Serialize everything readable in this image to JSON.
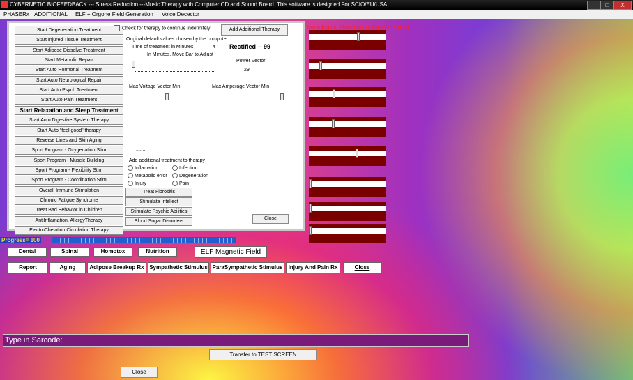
{
  "window": {
    "title": "CYBERNETIC BIOFEEDBACK  ---  Stress Reduction    ---Music Therapy with Computer CD and Sound Board.  This software is designed For SCIO/EU/USA",
    "controls": [
      "_",
      "□",
      "X"
    ]
  },
  "menu": [
    "PHASERx",
    "ADDITIONAL",
    "ELF + Orgone Field Generation",
    "Voice Decector"
  ],
  "treatments": [
    "Start Degeneration Treatment",
    "Start Injured Tissue Treatment",
    "Start Adipose Dissolve Treatment",
    "Start Metabolic Repair",
    "Start Auto Hormonal Treatment",
    "Start Auto Neurological Repair",
    "Start Auto Psych Treatment",
    "Start Auto Pain Treatment",
    "Start Relaxation and Sleep Treatment",
    "Start Auto Digestive System Therapy",
    "Start Auto \"feel good\" therapy",
    "Reverse Lines and Skin Aging",
    "Sport Program - Oxygenation Stim",
    "Sport Program - Muscle Building",
    "Sport Program - Flexibility Stim",
    "Sport Program - Coordination Stim",
    "Overall Immune Stimulation",
    "Chronic Fatigue Syndrome",
    "Treat Bad Behavior  in Children",
    "AntiInflamation, AllergyTherapy",
    "ElectroChelation Circulation Therapy"
  ],
  "panel": {
    "check_continue": "Check for therapy to continue indefinitely",
    "add_therapy_button": "Add Additional Therapy",
    "defaults_note": "Original default values chosen by the computer",
    "time_label": "Time of treatment in Minutes",
    "time_value": "4",
    "minutes_note": "In Minutes, Move Bar to Adjust",
    "rectified": "Rectified -- 99",
    "power_vector_label": "Power Vector",
    "power_vector_value": "29",
    "voltage_label": "Max    Voltage Vector    Min",
    "amperage_label": "Max    Amperage Vector    Min",
    "dots": ".......",
    "add_additional_label": "Add additional treatment to therapy",
    "options": [
      [
        "Inflamation",
        "Infection"
      ],
      [
        "Metabolic error",
        "Degeneration"
      ],
      [
        "Injury",
        "Pain"
      ]
    ],
    "extra_buttons": [
      "Treat Fibrositis",
      "Stimulate Intellect",
      "Stimulate Psychic Abilities",
      "Blood Sugar Disorders"
    ],
    "close_button": "Close"
  },
  "side": {
    "heading": "Neurological Aberation In Stanine Percent",
    "slider_positions": [
      0.65,
      0.14,
      0.32,
      0.31,
      0.63,
      0.0,
      0.0,
      0.0,
      0.02
    ]
  },
  "progress": {
    "label": "Progress= 100",
    "value": 100
  },
  "row1": [
    "Dental",
    "Spinal",
    "Homotox",
    "Nutrition"
  ],
  "elf_button": "ELF Magnetic Field",
  "row2": [
    "Report",
    "Aging",
    "Adipose Breakup Rx",
    "Sympathetic Stimulus",
    "ParaSympathetic Stimulus",
    "Injury And Pain Rx",
    "Close"
  ],
  "dash": "----",
  "sarcode_label": "Type in Sarcode:",
  "transfer_button": "Transfer to TEST SCREEN",
  "bottom_close": "Close",
  "colors": {
    "bar": "#7a0000",
    "progress": "#1f5fd0",
    "sarcode": "#7a1a7a",
    "alert": "#ff2020"
  }
}
